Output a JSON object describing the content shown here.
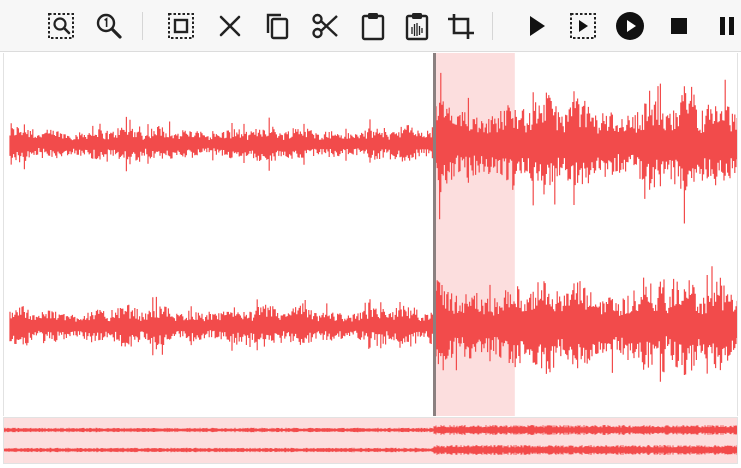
{
  "toolbar": {
    "buttons": [
      {
        "id": "zoom-selection",
        "icon": "zoom-to-selection-icon"
      },
      {
        "id": "zoom-reset",
        "icon": "zoom-one-to-one-icon"
      },
      {
        "id": "select-all",
        "icon": "select-all-icon"
      },
      {
        "id": "clear-selection",
        "icon": "close-icon"
      },
      {
        "id": "copy",
        "icon": "copy-icon"
      },
      {
        "id": "cut",
        "icon": "scissors-icon"
      },
      {
        "id": "paste",
        "icon": "clipboard-icon"
      },
      {
        "id": "paste-mix",
        "icon": "clipboard-audio-icon"
      },
      {
        "id": "crop",
        "icon": "crop-icon"
      },
      {
        "id": "play",
        "icon": "play-icon"
      },
      {
        "id": "play-selection",
        "icon": "play-selection-icon"
      },
      {
        "id": "play-circle",
        "icon": "play-circle-icon"
      },
      {
        "id": "stop",
        "icon": "stop-icon"
      },
      {
        "id": "pause",
        "icon": "pause-icon"
      }
    ]
  },
  "waveform": {
    "channels": 2,
    "wave_color": "#f24b4b",
    "selection_color": "#fcdede",
    "cursor_color": "#8b8080",
    "selection_start_fraction": 0.585,
    "selection_end_fraction": 0.695,
    "loud_section_start_fraction": 0.585
  },
  "overview": {
    "visible_region_color": "#fcdede"
  }
}
